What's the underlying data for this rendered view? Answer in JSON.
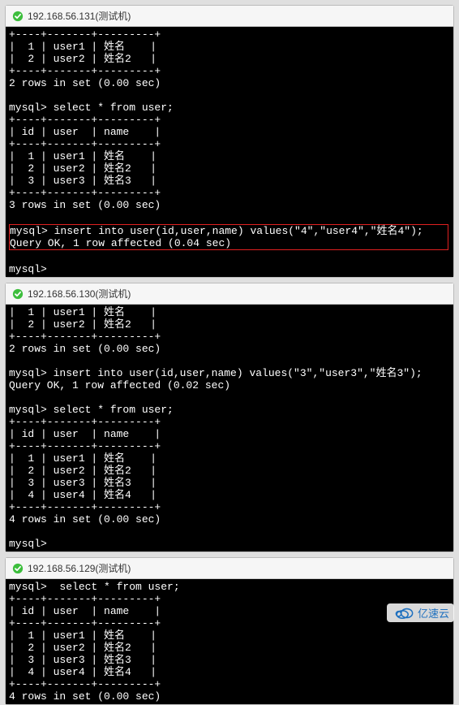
{
  "panels": [
    {
      "host": "192.168.56.131(测试机)",
      "terminal": [
        "+----+-------+---------+",
        "|  1 | user1 | 姓名    |",
        "|  2 | user2 | 姓名2   |",
        "+----+-------+---------+",
        "2 rows in set (0.00 sec)",
        "",
        "mysql> select * from user;",
        "+----+-------+---------+",
        "| id | user  | name    |",
        "+----+-------+---------+",
        "|  1 | user1 | 姓名    |",
        "|  2 | user2 | 姓名2   |",
        "|  3 | user3 | 姓名3   |",
        "+----+-------+---------+",
        "3 rows in set (0.00 sec)",
        "",
        {
          "highlight": true,
          "lines": [
            "mysql> insert into user(id,user,name) values(\"4\",\"user4\",\"姓名4\");",
            "Query OK, 1 row affected (0.04 sec)"
          ]
        },
        "",
        "mysql>"
      ]
    },
    {
      "host": "192.168.56.130(测试机)",
      "terminal": [
        "|  1 | user1 | 姓名    |",
        "|  2 | user2 | 姓名2   |",
        "+----+-------+---------+",
        "2 rows in set (0.00 sec)",
        "",
        "mysql> insert into user(id,user,name) values(\"3\",\"user3\",\"姓名3\");",
        "Query OK, 1 row affected (0.02 sec)",
        "",
        "mysql> select * from user;",
        "+----+-------+---------+",
        "| id | user  | name    |",
        "+----+-------+---------+",
        "|  1 | user1 | 姓名    |",
        "|  2 | user2 | 姓名2   |",
        "|  3 | user3 | 姓名3   |",
        "|  4 | user4 | 姓名4   |",
        "+----+-------+---------+",
        "4 rows in set (0.00 sec)",
        "",
        "mysql>"
      ]
    },
    {
      "host": "192.168.56.129(测试机)",
      "terminal": [
        "mysql>  select * from user;",
        "+----+-------+---------+",
        "| id | user  | name    |",
        "+----+-------+---------+",
        "|  1 | user1 | 姓名    |",
        "|  2 | user2 | 姓名2   |",
        "|  3 | user3 | 姓名3   |",
        "|  4 | user4 | 姓名4   |",
        "+----+-------+---------+",
        "4 rows in set (0.00 sec)"
      ]
    }
  ],
  "watermark": {
    "text": "亿速云"
  }
}
